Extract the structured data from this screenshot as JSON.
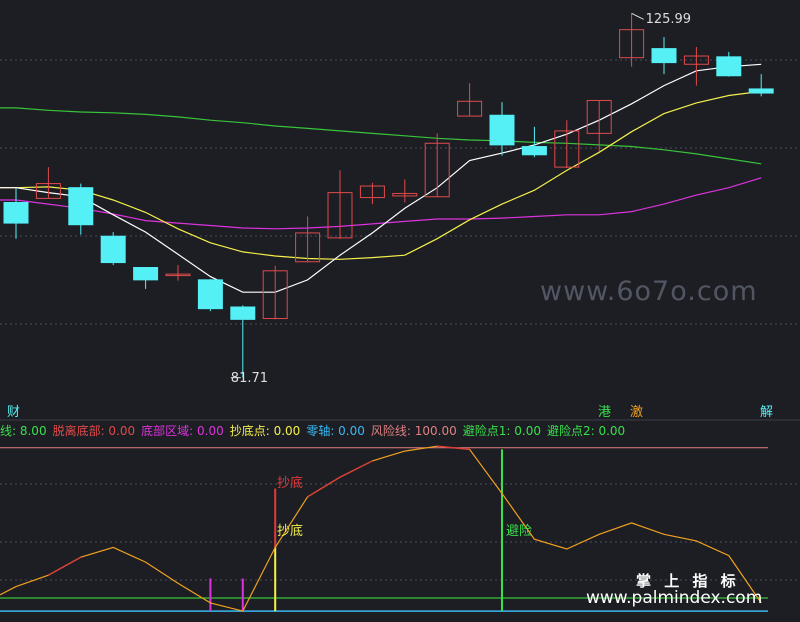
{
  "colors": {
    "background": "#1c1e24",
    "up_candle": "#e04a4a",
    "down_candle": "#54f0f5",
    "ma_white": "#ffffff",
    "ma_yellow": "#f5f04a",
    "ma_magenta": "#dd33dd",
    "ma_green": "#39c43a",
    "grid": "#4a4e58"
  },
  "price_labels": {
    "high": "125.99",
    "low": "81.71"
  },
  "event_tags": [
    {
      "text": "财",
      "color": "#54f0f5"
    },
    {
      "text": "港",
      "color": "#39e04a"
    },
    {
      "text": "激",
      "color": "#f0a020"
    },
    {
      "text": "解",
      "color": "#54f0f5"
    }
  ],
  "legend": [
    {
      "text": "线: 8.00",
      "color": "#39e04a"
    },
    {
      "text": "脱离底部: 0.00",
      "color": "#e04a4a"
    },
    {
      "text": "底部区域: 0.00",
      "color": "#dd33dd"
    },
    {
      "text": "抄底点: 0.00",
      "color": "#f5f04a"
    },
    {
      "text": "零轴: 0.00",
      "color": "#3ab8f0"
    },
    {
      "text": "风险线: 100.00",
      "color": "#e08080"
    },
    {
      "text": "避险点1: 0.00",
      "color": "#39e04a"
    },
    {
      "text": "避险点2: 0.00",
      "color": "#39e04a"
    }
  ],
  "indicator_labels": {
    "buy_top": "抄底",
    "buy_bottom": "抄底",
    "risk": "避险"
  },
  "watermarks": {
    "site_faint": "www.6o7o.com",
    "brand": "掌 上 指 标",
    "site": "www.palmindex.com"
  },
  "chart_data": {
    "type": "candlestick",
    "price_panel": {
      "ylim": [
        79,
        127
      ],
      "candles": [
        {
          "open": 103.0,
          "close": 100.5,
          "high": 104.7,
          "low": 98.6
        },
        {
          "open": 103.5,
          "close": 105.3,
          "high": 107.3,
          "low": 103.5
        },
        {
          "open": 104.8,
          "close": 100.3,
          "high": 105.3,
          "low": 99.1
        },
        {
          "open": 98.9,
          "close": 95.7,
          "high": 99.4,
          "low": 95.4
        },
        {
          "open": 95.1,
          "close": 93.6,
          "high": 95.1,
          "low": 92.5
        },
        {
          "open": 94.3,
          "close": 94.3,
          "high": 95.4,
          "low": 93.5
        },
        {
          "open": 93.6,
          "close": 90.1,
          "high": 93.7,
          "low": 89.8
        },
        {
          "open": 90.3,
          "close": 88.8,
          "high": 90.5,
          "low": 81.71
        },
        {
          "open": 88.9,
          "close": 94.7,
          "high": 95.3,
          "low": 88.8
        },
        {
          "open": 95.8,
          "close": 99.3,
          "high": 101.3,
          "low": 95.8
        },
        {
          "open": 98.7,
          "close": 104.2,
          "high": 106.9,
          "low": 98.6
        },
        {
          "open": 103.6,
          "close": 105.0,
          "high": 105.4,
          "low": 102.8
        },
        {
          "open": 103.8,
          "close": 104.1,
          "high": 105.8,
          "low": 103.0
        },
        {
          "open": 103.7,
          "close": 110.2,
          "high": 111.4,
          "low": 103.7
        },
        {
          "open": 113.5,
          "close": 115.3,
          "high": 117.5,
          "low": 113.5
        },
        {
          "open": 113.6,
          "close": 110.0,
          "high": 115.2,
          "low": 108.7
        },
        {
          "open": 109.8,
          "close": 108.8,
          "high": 112.2,
          "low": 108.5
        },
        {
          "open": 107.3,
          "close": 111.7,
          "high": 113.0,
          "low": 107.2
        },
        {
          "open": 111.4,
          "close": 115.4,
          "high": 115.4,
          "low": 109.2
        },
        {
          "open": 120.6,
          "close": 124.0,
          "high": 125.99,
          "low": 119.5
        },
        {
          "open": 121.7,
          "close": 120.0,
          "high": 123.1,
          "low": 118.6
        },
        {
          "open": 119.8,
          "close": 120.8,
          "high": 121.9,
          "low": 117.2
        },
        {
          "open": 120.7,
          "close": 118.4,
          "high": 121.3,
          "low": 118.3
        },
        {
          "open": 116.8,
          "close": 116.3,
          "high": 118.6,
          "low": 115.9
        }
      ],
      "ma_white": [
        104.8,
        104.2,
        103.7,
        101.5,
        99.4,
        96.7,
        94.0,
        92.1,
        92.1,
        93.6,
        96.6,
        99.3,
        102.3,
        104.8,
        108.1,
        109.0,
        110.0,
        111.3,
        113.0,
        115.0,
        117.2,
        119.0,
        119.5,
        119.8
      ],
      "ma_yellow": [
        104.8,
        104.9,
        104.5,
        103.3,
        101.8,
        99.8,
        98.1,
        97.0,
        96.5,
        96.2,
        96.1,
        96.3,
        96.6,
        98.6,
        100.9,
        102.8,
        104.5,
        106.9,
        109.1,
        111.6,
        113.8,
        115.1,
        116.0,
        116.5
      ],
      "ma_magenta": [
        103.3,
        102.8,
        102.3,
        101.6,
        100.8,
        100.5,
        100.2,
        99.9,
        99.8,
        99.9,
        100.1,
        100.4,
        100.7,
        101.0,
        101.0,
        101.1,
        101.3,
        101.5,
        101.5,
        101.9,
        102.8,
        103.9,
        104.8,
        106.0
      ],
      "ma_green": [
        114.5,
        114.2,
        114.0,
        113.9,
        113.7,
        113.4,
        113.0,
        112.7,
        112.3,
        112.0,
        111.7,
        111.4,
        111.1,
        110.8,
        110.6,
        110.5,
        110.3,
        110.2,
        110.0,
        109.8,
        109.4,
        108.9,
        108.3,
        107.7
      ]
    },
    "indicator_panel": {
      "ylim": [
        -3,
        106
      ],
      "risk_line": 100,
      "zero_line": 0,
      "green_line": 8,
      "curve": [
        15,
        22,
        33,
        39,
        30,
        17,
        5,
        0,
        39,
        70,
        82,
        92,
        98,
        101,
        99,
        72,
        44,
        38,
        47,
        54,
        47,
        43,
        34,
        5
      ],
      "red_segments": [
        [
          1,
          2
        ],
        [
          9,
          11
        ],
        [
          13,
          14
        ]
      ],
      "magenta_bars": [
        6,
        7
      ],
      "yellow_bars": [
        8
      ],
      "red_bars": [
        8
      ],
      "green_bars": [
        15
      ]
    }
  }
}
